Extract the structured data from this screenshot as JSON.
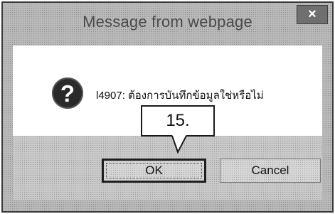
{
  "dialog": {
    "title": "Message from webpage",
    "close_symbol": "×",
    "icon": "question-icon",
    "icon_glyph": "?",
    "message": "l4907: ต้องการบันทึกข้อมูลใช่หรือไม่",
    "buttons": {
      "ok_label": "OK",
      "cancel_label": "Cancel"
    }
  },
  "annotation": {
    "step_label": "15."
  }
}
